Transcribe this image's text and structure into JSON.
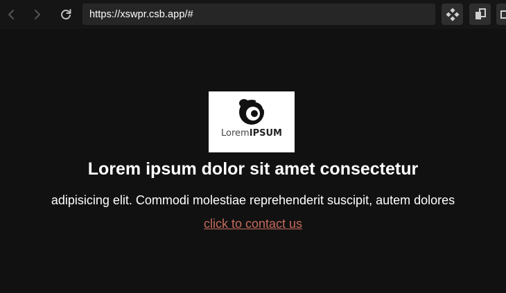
{
  "browser": {
    "url": "https://xswpr.csb.app/#",
    "icons": {
      "back": "arrow-left-icon",
      "forward": "arrow-right-icon",
      "reload": "reload-icon",
      "extension_1": "diamond-dots-icon",
      "extension_2": "copy-pages-icon",
      "extension_3": "window-icon"
    }
  },
  "page": {
    "logo": {
      "text_light": "Lorem",
      "text_bold": "IPSUM"
    },
    "headline": "Lorem ipsum dolor sit amet consectetur",
    "subtext": "adipisicing elit. Commodi molestiae reprehenderit suscipit, autem dolores",
    "link_text": "click to contact us"
  },
  "colors": {
    "background": "#111111",
    "toolbar": "#151515",
    "address_bar": "#262626",
    "text": "#ffffff",
    "link": "#c56a5c"
  }
}
